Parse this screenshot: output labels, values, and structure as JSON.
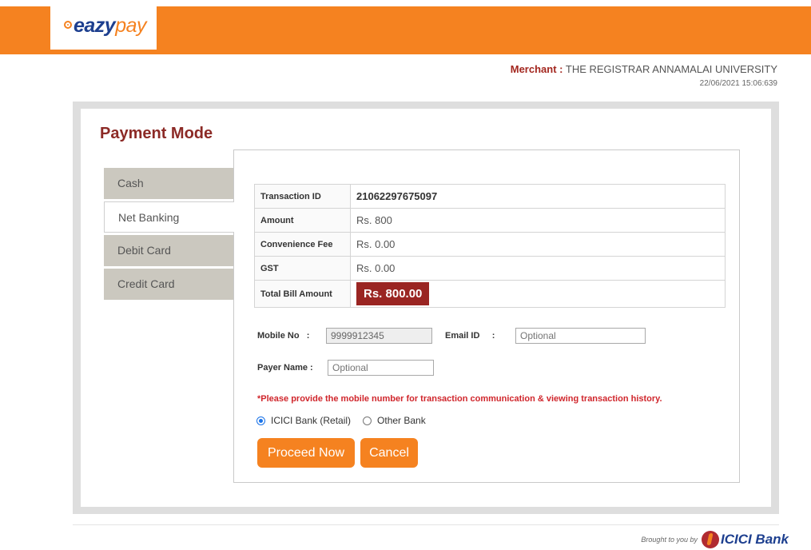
{
  "brand": {
    "logo_main": "eazy",
    "logo_accent": "pay"
  },
  "merchant": {
    "label": "Merchant",
    "separator": ":",
    "name": "THE REGISTRAR ANNAMALAI UNIVERSITY",
    "datetime": "22/06/2021 15:06:639"
  },
  "payment": {
    "title": "Payment Mode",
    "tabs": [
      {
        "label": "Cash",
        "active": false
      },
      {
        "label": "Net Banking",
        "active": true
      },
      {
        "label": "Debit Card",
        "active": false
      },
      {
        "label": "Credit Card",
        "active": false
      }
    ]
  },
  "summary": {
    "rows": [
      {
        "label": "Transaction ID",
        "value": "21062297675097"
      },
      {
        "label": "Amount",
        "value": "Rs. 800"
      },
      {
        "label": "Convenience Fee",
        "value": "Rs. 0.00"
      },
      {
        "label": "GST",
        "value": "Rs. 0.00"
      },
      {
        "label": "Total Bill Amount",
        "value": "Rs. 800.00"
      }
    ]
  },
  "form": {
    "mobile_label": "Mobile No",
    "mobile_sep": ":",
    "mobile_value": "9999912345",
    "email_label": "Email ID",
    "email_sep": ":",
    "email_placeholder": "Optional",
    "payer_label": "Payer Name :",
    "payer_placeholder": "Optional",
    "note": "*Please provide the mobile number for transaction communication & viewing transaction history.",
    "bank_options": [
      {
        "label": "ICICI Bank (Retail)",
        "selected": true
      },
      {
        "label": "Other Bank",
        "selected": false
      }
    ],
    "proceed_label": "Proceed Now",
    "cancel_label": "Cancel"
  },
  "footer": {
    "brought_by": "Brought to you by",
    "bank_name": "ICICI Bank"
  },
  "colors": {
    "accent": "#f58220",
    "brand_red": "#9a2522",
    "note_red": "#d0262c"
  }
}
